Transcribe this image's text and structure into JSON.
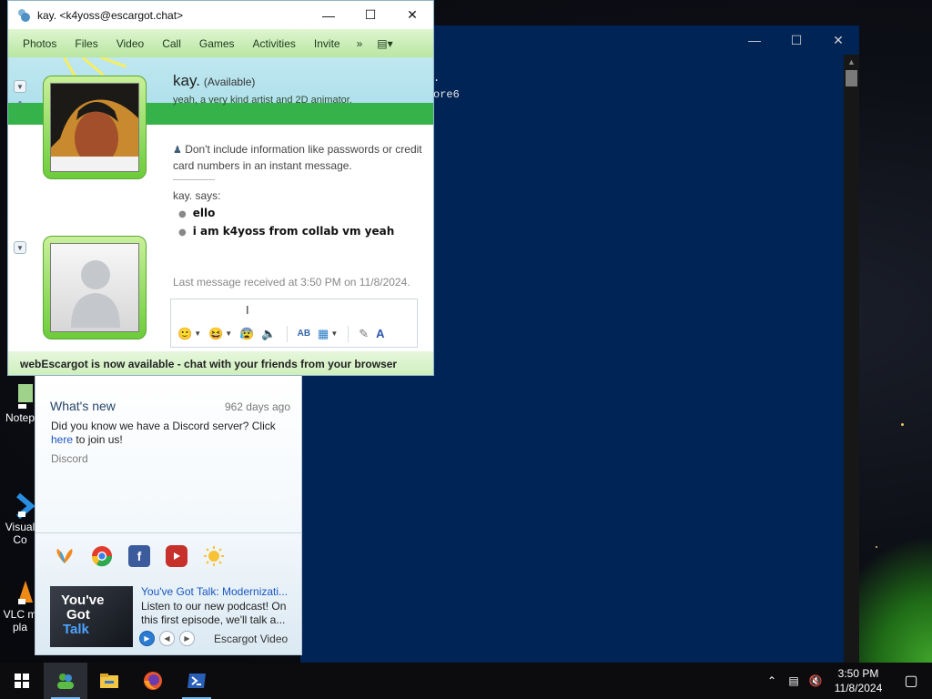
{
  "desktop": {
    "icons": [
      {
        "label": "Notep",
        "icon": "notepad-icon"
      },
      {
        "label": "Visual\nCo",
        "icon": "vscode-icon"
      },
      {
        "label": "VLC m\npla",
        "icon": "vlc-icon"
      }
    ]
  },
  "powershell": {
    "lines": [
      ".",
      "ore6"
    ]
  },
  "chat": {
    "title": "kay. <k4yoss@escargot.chat>",
    "menu": [
      "Photos",
      "Files",
      "Video",
      "Call",
      "Games",
      "Activities",
      "Invite"
    ],
    "menu_more": "»",
    "contact": {
      "name": "kay.",
      "status": "(Available)",
      "personal_message": "yeah, a very kind artist and 2D animator."
    },
    "warning": "Don't include information like passwords or credit card numbers in an instant message.",
    "says": "kay. says:",
    "messages": [
      "ello",
      "i am k4yoss from collab vm yeah"
    ],
    "last_received": "Last message received at 3:50 PM on 11/8/2024.",
    "status_bar": "webEscargot is now available - chat with your friends from your browser"
  },
  "contacts_window": {
    "news": {
      "title": "What's new",
      "age": "962 days ago",
      "body_prefix": "Did you know we have a Discord server? Click ",
      "body_link": "here",
      "body_suffix": " to join us!",
      "source": "Discord"
    },
    "social_icons": [
      "msn-butterfly-icon",
      "chrome-icon",
      "facebook-icon",
      "youtube-icon",
      "weather-sun-icon"
    ],
    "video": {
      "thumb_lines": [
        "You've",
        "Got",
        "Talk"
      ],
      "title": "You've Got Talk: Modernizati...",
      "description": "Listen to our new podcast! On this first episode, we'll talk a...",
      "source": "Escargot Video"
    }
  },
  "taskbar": {
    "apps": [
      "start-icon",
      "messenger-icon",
      "file-explorer-icon",
      "firefox-icon",
      "powershell-icon"
    ],
    "time": "3:50 PM",
    "date": "11/8/2024"
  },
  "colors": {
    "powershell_bg": "#012456",
    "messenger_green": "#b9e6a2",
    "link_blue": "#1a56c0"
  }
}
